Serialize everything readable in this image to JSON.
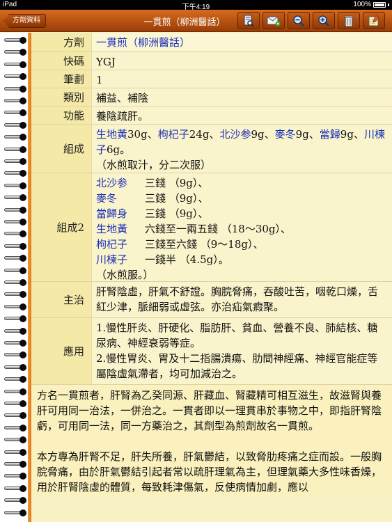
{
  "status_bar": {
    "device": "iPad",
    "time": "下午4:19",
    "battery": "100%"
  },
  "toolbar": {
    "back_label": "方劑資料",
    "title": "一貫煎（柳洲醫話）",
    "buttons": [
      "book-search-icon",
      "mail-icon",
      "zoom-out-icon",
      "zoom-in-icon",
      "trash-icon",
      "notes-icon"
    ]
  },
  "fields": {
    "name": {
      "label": "方劑",
      "value": "一貫煎（柳洲醫話）"
    },
    "code": {
      "label": "快碼",
      "value": "YGJ"
    },
    "strokes": {
      "label": "筆劃",
      "value": "1"
    },
    "category": {
      "label": "類別",
      "value": "補益、補陰"
    },
    "function": {
      "label": "功能",
      "value": "養陰疏肝。"
    },
    "composition": {
      "label": "組成",
      "segments": [
        {
          "text": "生地黃",
          "link": true
        },
        {
          "text": "30g、",
          "link": false
        },
        {
          "text": "枸杞子",
          "link": true
        },
        {
          "text": "24g、",
          "link": false
        },
        {
          "text": "北沙参",
          "link": true
        },
        {
          "text": "9g、",
          "link": false
        },
        {
          "text": "麥冬",
          "link": true
        },
        {
          "text": "9g、",
          "link": false
        },
        {
          "text": "當歸",
          "link": true
        },
        {
          "text": "9g、",
          "link": false
        },
        {
          "text": "川楝子",
          "link": true
        },
        {
          "text": "6g。",
          "link": false
        }
      ],
      "note": "（水煎取汁，分二次服）"
    },
    "composition2": {
      "label": "組成2",
      "herbs": [
        {
          "name": "北沙参",
          "dose": "三錢 （9g）、"
        },
        {
          "name": "麥冬",
          "dose": "三錢 （9g）、"
        },
        {
          "name": "當歸身",
          "dose": "三錢 （9g）、"
        },
        {
          "name": "生地黃",
          "dose": "六錢至一兩五錢 （18～30g）、"
        },
        {
          "name": "枸杞子",
          "dose": "三錢至六錢 （9～18g）、"
        },
        {
          "name": "川楝子",
          "dose": "一錢半 （4.5g）。"
        }
      ],
      "note": "（水煎服。）"
    },
    "indications": {
      "label": "主治",
      "value": "肝腎陰虛，肝氣不舒證。胸脘脅痛，吞酸吐苦，咽乾口燥，舌紅少津，脈細弱或虛弦。亦治疝氣瘕聚。"
    },
    "usage": {
      "label": "應用",
      "items": [
        "1.慢性肝炎、肝硬化、脂肪肝、貧血、營養不良、肺結核、糖尿病、神經衰弱等症。",
        "2.慢性胃炎、胃及十二指腸潰瘍、肋間神經痛、神經官能症等屬陰虛氣滯者，均可加減治之。"
      ]
    }
  },
  "article": {
    "paragraphs": [
      "方名一貫煎者，肝腎為乙癸同源、肝藏血、腎藏精可相互滋生，故滋腎與養肝可用同一治法，一併治之。一貫者即以一理貫串於事物之中，即指肝腎陰虧，可用同一法，同一方藥治之，其劑型為煎劑故名一貫煎。",
      "本方專為肝腎不足，肝失所養，肝氣鬱結，以致脅肋疼痛之症而設。一般胸脘脅痛，由於肝氣鬱結引起者常以疏肝理氣為主，但理氣藥大多性味香燥，用於肝腎陰虛的體質，每致耗津傷氣，反使病情加劇，應以"
    ]
  }
}
